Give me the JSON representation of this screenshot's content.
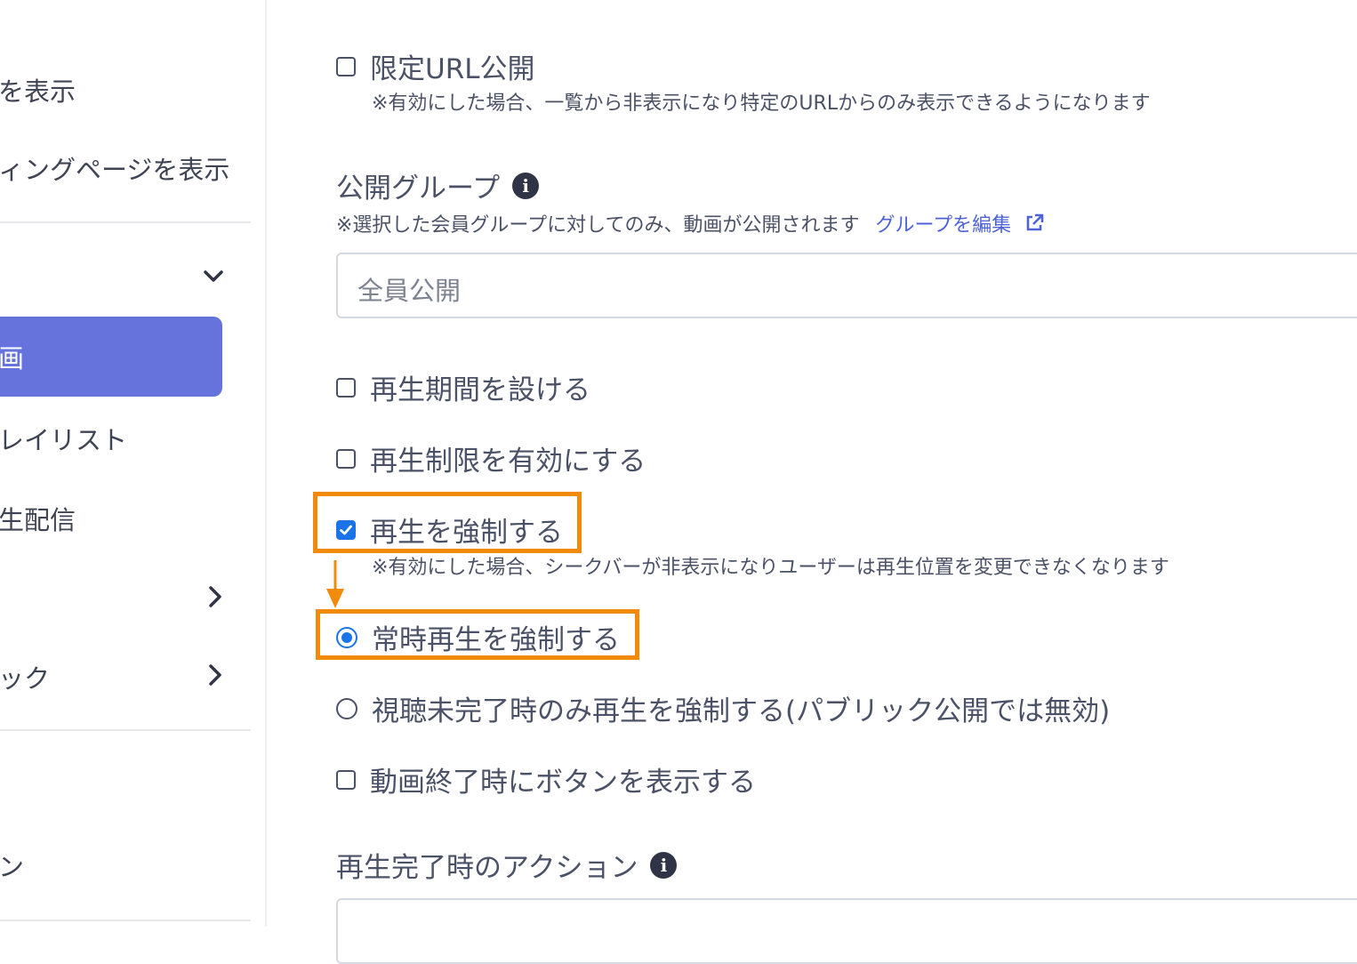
{
  "sidebar": {
    "items": [
      {
        "label": "を表示"
      },
      {
        "label": "ィングページを表示"
      },
      {
        "label": "画"
      },
      {
        "label": "レイリスト"
      },
      {
        "label": "生配信"
      },
      {
        "label": "ック"
      },
      {
        "label": "ン"
      }
    ]
  },
  "form": {
    "limited_url": {
      "label": "限定URL公開",
      "note": "※有効にした場合、一覧から非表示になり特定のURLからのみ表示できるようになります"
    },
    "public_group": {
      "heading": "公開グループ",
      "note": "※選択した会員グループに対してのみ、動画が公開されます",
      "edit_link": "グループを編集",
      "value": "全員公開"
    },
    "playback_period": {
      "label": "再生期間を設ける"
    },
    "playback_limit": {
      "label": "再生制限を有効にする"
    },
    "force_playback": {
      "label": "再生を強制する",
      "note": "※有効にした場合、シークバーが非表示になりユーザーは再生位置を変更できなくなります"
    },
    "always_force": {
      "label": "常時再生を強制する"
    },
    "incomplete_only": {
      "label": "視聴未完了時のみ再生を強制する(パブリック公開では無効)"
    },
    "end_button": {
      "label": "動画終了時にボタンを表示する"
    },
    "completion_action": {
      "heading": "再生完了時のアクション"
    }
  },
  "colors": {
    "accent": "#6673dd",
    "highlight": "#f28a0b",
    "check": "#1a73e8"
  }
}
